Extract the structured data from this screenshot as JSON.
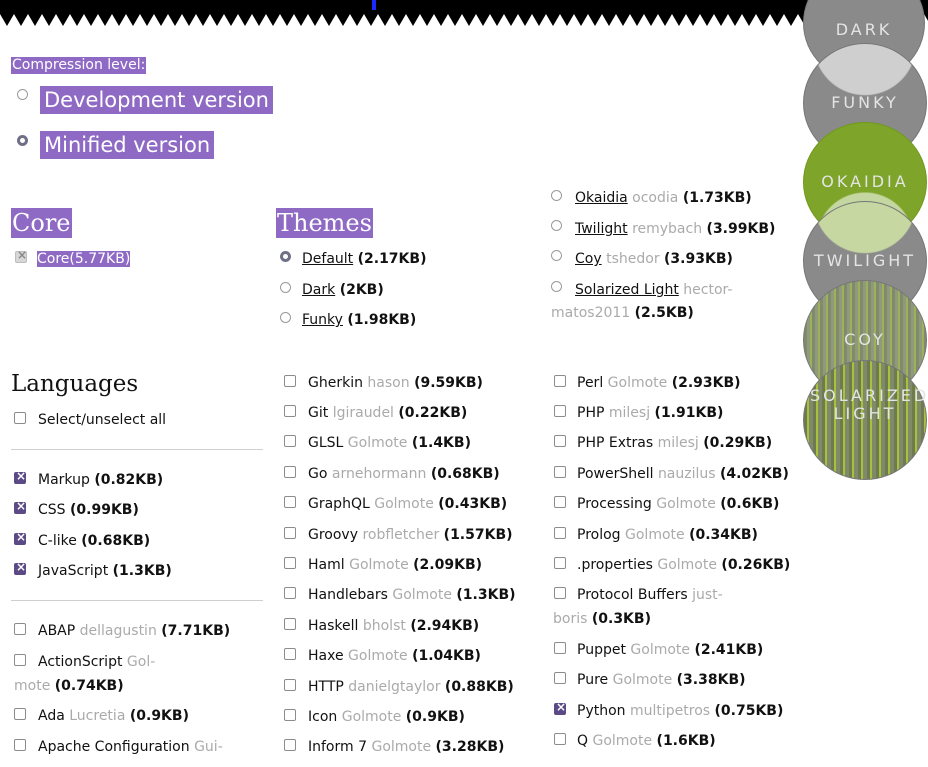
{
  "compression": {
    "label": "Compression level:",
    "options": [
      {
        "label": "Development version",
        "selected": false
      },
      {
        "label": "Minified version",
        "selected": true
      }
    ]
  },
  "core": {
    "heading": "Core",
    "item": {
      "name": "Core",
      "size": "(5.77KB)"
    }
  },
  "themes": {
    "heading": "Themes",
    "items": [
      {
        "name": "Default",
        "author": "",
        "size": "(2.17KB)",
        "selected": true
      },
      {
        "name": "Dark",
        "author": "",
        "size": "(2KB)",
        "selected": false
      },
      {
        "name": "Funky",
        "author": "",
        "size": "(1.98KB)",
        "selected": false
      },
      {
        "name": "Okaidia",
        "author": "ocodia",
        "size": "(1.73KB)",
        "selected": false
      },
      {
        "name": "Twilight",
        "author": "remybach",
        "size": "(3.99KB)",
        "selected": false
      },
      {
        "name": "Coy",
        "author": "tshedor",
        "size": "(3.93KB)",
        "selected": false
      },
      {
        "name": "Solarized Light",
        "author": "hector-",
        "author2": "matos2011",
        "size": "(2.5KB)",
        "selected": false
      }
    ]
  },
  "languages": {
    "heading": "Languages",
    "select_all": "Select/unselect all",
    "col1_checked": [
      {
        "name": "Markup",
        "size": "(0.82KB)"
      },
      {
        "name": "CSS",
        "size": "(0.99KB)"
      },
      {
        "name": "C-like",
        "size": "(0.68KB)"
      },
      {
        "name": "JavaScript",
        "size": "(1.3KB)"
      }
    ],
    "col1_rest": [
      {
        "name": "ABAP",
        "author": "dellagustin",
        "size": "(7.71KB)"
      },
      {
        "name": "ActionScript",
        "author": "Gol-",
        "author2": "mote",
        "size": "(0.74KB)"
      },
      {
        "name": "Ada",
        "author": "Lucretia",
        "size": "(0.9KB)"
      },
      {
        "name": "Apache Configuration",
        "author": "Gui-",
        "author2": "",
        "size": ""
      }
    ],
    "col2": [
      {
        "name": "Gherkin",
        "author": "hason",
        "size": "(9.59KB)"
      },
      {
        "name": "Git",
        "author": "lgiraudel",
        "size": "(0.22KB)"
      },
      {
        "name": "GLSL",
        "author": "Golmote",
        "size": "(1.4KB)"
      },
      {
        "name": "Go",
        "author": "arnehormann",
        "size": "(0.68KB)"
      },
      {
        "name": "GraphQL",
        "author": "Golmote",
        "size": "(0.43KB)"
      },
      {
        "name": "Groovy",
        "author": "robfletcher",
        "size": "(1.57KB)"
      },
      {
        "name": "Haml",
        "author": "Golmote",
        "size": "(2.09KB)"
      },
      {
        "name": "Handlebars",
        "author": "Golmote",
        "size": "(1.3KB)"
      },
      {
        "name": "Haskell",
        "author": "bholst",
        "size": "(2.94KB)"
      },
      {
        "name": "Haxe",
        "author": "Golmote",
        "size": "(1.04KB)"
      },
      {
        "name": "HTTP",
        "author": "danielgtaylor",
        "size": "(0.88KB)"
      },
      {
        "name": "Icon",
        "author": "Golmote",
        "size": "(0.9KB)"
      },
      {
        "name": "Inform 7",
        "author": "Golmote",
        "size": "(3.28KB)"
      }
    ],
    "col3": [
      {
        "name": "Perl",
        "author": "Golmote",
        "size": "(2.93KB)",
        "checked": false
      },
      {
        "name": "PHP",
        "author": "milesj",
        "size": "(1.91KB)",
        "checked": false
      },
      {
        "name": "PHP Extras",
        "author": "milesj",
        "size": "(0.29KB)",
        "checked": false
      },
      {
        "name": "PowerShell",
        "author": "nauzilus",
        "size": "(4.02KB)",
        "checked": false
      },
      {
        "name": "Processing",
        "author": "Golmote",
        "size": "(0.6KB)",
        "checked": false
      },
      {
        "name": "Prolog",
        "author": "Golmote",
        "size": "(0.34KB)",
        "checked": false
      },
      {
        "name": ".properties",
        "author": "Golmote",
        "size": "(0.26KB)",
        "checked": false
      },
      {
        "name": "Protocol Buffers",
        "author": "just-",
        "author2": "boris",
        "size": "(0.3KB)",
        "checked": false
      },
      {
        "name": "Puppet",
        "author": "Golmote",
        "size": "(2.41KB)",
        "checked": false
      },
      {
        "name": "Pure",
        "author": "Golmote",
        "size": "(3.38KB)",
        "checked": false
      },
      {
        "name": "Python",
        "author": "multipetros",
        "size": "(0.75KB)",
        "checked": true
      },
      {
        "name": "Q",
        "author": "Golmote",
        "size": "(1.6KB)",
        "checked": false
      }
    ]
  },
  "theme_previews": [
    "DARK",
    "FUNKY",
    "OKAIDIA",
    "TWILIGHT",
    "COY",
    "SOLARIZED LIGHT"
  ]
}
